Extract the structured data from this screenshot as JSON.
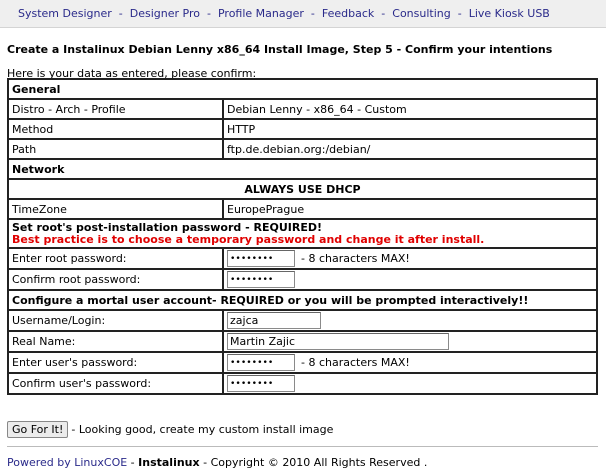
{
  "nav": {
    "items": [
      "System Designer",
      "Designer Pro",
      "Profile Manager",
      "Feedback",
      "Consulting",
      "Live Kiosk USB"
    ],
    "separator": "-"
  },
  "page": {
    "title": "Create a Instalinux Debian Lenny x86_64 Install Image, Step 5 - Confirm your intentions",
    "intro": "Here is your data as entered, please confirm:"
  },
  "general": {
    "heading": "General",
    "rows": [
      {
        "label": "Distro - Arch - Profile",
        "value": "Debian Lenny - x86_64 - Custom"
      },
      {
        "label": "Method",
        "value": "HTTP"
      },
      {
        "label": "Path",
        "value": "ftp.de.debian.org:/debian/"
      }
    ]
  },
  "network": {
    "heading": "Network",
    "dhcp": "ALWAYS USE DHCP",
    "timezone_label": "TimeZone",
    "timezone_value": "EuropePrague"
  },
  "root": {
    "heading": "Set root's post-installation password - REQUIRED!",
    "advice": "Best practice is to choose a temporary password and change it after install.",
    "password_label": "Enter root password:",
    "password_value": "••••••••",
    "password_hint": "- 8 characters MAX!",
    "confirm_label": "Confirm root password:",
    "confirm_value": "••••••••"
  },
  "user": {
    "heading": "Configure a mortal user account- REQUIRED or you will be prompted interactively!!",
    "login_label": "Username/Login:",
    "login_value": "zajca",
    "realname_label": "Real Name:",
    "realname_value": "Martin Zajic",
    "password_label": "Enter user's password:",
    "password_value": "••••••••",
    "password_hint": "- 8 characters MAX!",
    "confirm_label": "Confirm user's password:",
    "confirm_value": "••••••••"
  },
  "submit": {
    "button_label": "Go For It!",
    "message": "- Looking good, create my custom install image"
  },
  "footer": {
    "powered_link": "Powered by LinuxCOE",
    "separator1": " - ",
    "brand": "Instalinux",
    "copyright": " - Copyright © 2010 All Rights Reserved ."
  }
}
